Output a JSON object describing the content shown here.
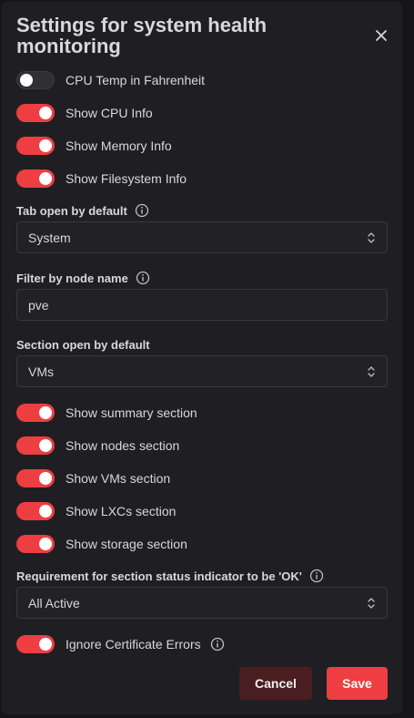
{
  "dialog": {
    "title": "Settings for system health monitoring",
    "close_icon": "close-icon"
  },
  "toggles_top": [
    {
      "label": "CPU Temp in Fahrenheit",
      "on": false
    },
    {
      "label": "Show CPU Info",
      "on": true
    },
    {
      "label": "Show Memory Info",
      "on": true
    },
    {
      "label": "Show Filesystem Info",
      "on": true
    }
  ],
  "tab_default": {
    "label": "Tab open by default",
    "value": "System"
  },
  "node_filter": {
    "label": "Filter by node name",
    "value": "pve"
  },
  "section_default": {
    "label": "Section open by default",
    "value": "VMs"
  },
  "toggles_sections": [
    {
      "label": "Show summary section",
      "on": true
    },
    {
      "label": "Show nodes section",
      "on": true
    },
    {
      "label": "Show VMs section",
      "on": true
    },
    {
      "label": "Show LXCs section",
      "on": true
    },
    {
      "label": "Show storage section",
      "on": true
    }
  ],
  "status_requirement": {
    "label": "Requirement for section status indicator to be 'OK'",
    "value": "All Active"
  },
  "ignore_cert": {
    "label": "Ignore Certificate Errors",
    "on": true
  },
  "buttons": {
    "cancel": "Cancel",
    "save": "Save"
  },
  "colors": {
    "accent": "#ee3e41",
    "cancel_bg": "#4a1e20",
    "panel": "#1f1f23"
  }
}
